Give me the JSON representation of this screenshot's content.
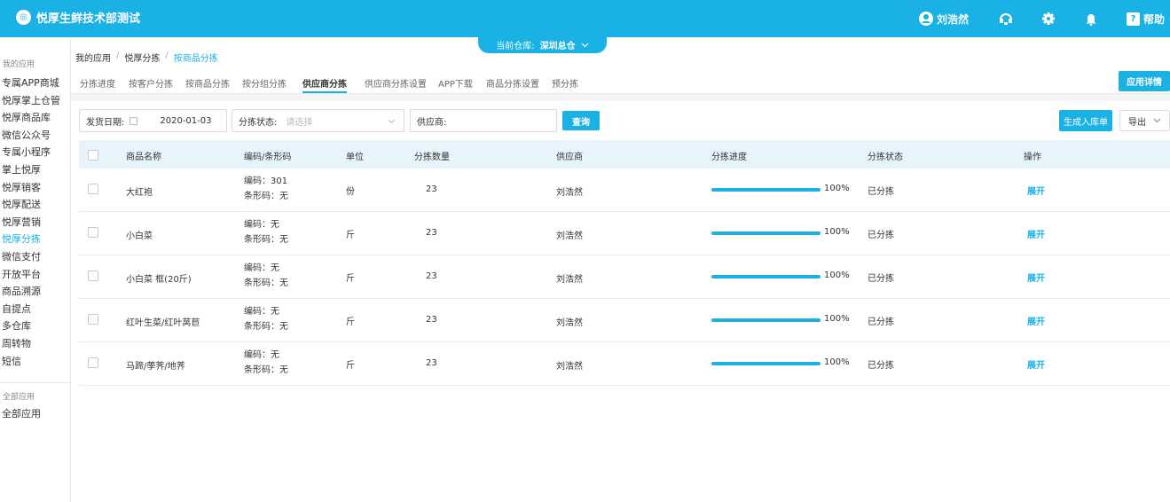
{
  "app": {
    "title": "悦厚生鲜技术部测试",
    "logo_glyph": "◎"
  },
  "top": {
    "user": "刘浩然",
    "help": "帮助",
    "accent": "#1ab1e5"
  },
  "warehouse": {
    "label": "当前仓库:",
    "value": "深圳总仓"
  },
  "sidebar": {
    "group_my": "我的应用",
    "items": [
      "专属APP商城",
      "悦厚掌上仓管",
      "悦厚商品库",
      "微信公众号",
      "专属小程序",
      "掌上悦厚",
      "悦厚销客",
      "悦厚配送",
      "悦厚营销",
      "悦厚分拣",
      "微信支付",
      "开放平台",
      "商品溯源",
      "自提点",
      "多仓库",
      "周转物",
      "短信"
    ],
    "active_index": 9,
    "group_all": "全部应用",
    "all_item": "全部应用"
  },
  "breadcrumb": [
    "我的应用",
    "悦厚分拣",
    "按商品分拣"
  ],
  "tabs": [
    "分拣进度",
    "按客户分拣",
    "按商品分拣",
    "按分组分拣",
    "供应商分拣",
    "供应商分拣设置",
    "APP下载",
    "商品分拣设置",
    "预分拣"
  ],
  "active_tab": 4,
  "app_detail_button": "应用详情",
  "filters": {
    "date_label": "发货日期:",
    "date_value": "2020-01-03",
    "status_label": "分拣状态:",
    "status_placeholder": "请选择",
    "supplier_label": "供应商:",
    "query_button": "查询",
    "inbound_button": "生成入库单",
    "export_button": "导出"
  },
  "table": {
    "headers": [
      "商品名称",
      "编码/条形码",
      "单位",
      "分拣数量",
      "供应商",
      "分拣进度",
      "分拣状态",
      "操作"
    ],
    "rows": [
      {
        "name": "大红袍",
        "code": "编码：301",
        "barcode": "条形码：无",
        "unit": "份",
        "qty": "23",
        "supplier": "刘浩然",
        "progress": 1.0,
        "progress_text": "100%",
        "status": "已分拣",
        "action": "展开"
      },
      {
        "name": "小白菜",
        "code": "编码：无",
        "barcode": "条形码：无",
        "unit": "斤",
        "qty": "23",
        "supplier": "刘浩然",
        "progress": 1.0,
        "progress_text": "100%",
        "status": "已分拣",
        "action": "展开"
      },
      {
        "name": "小白菜 框(20斤)",
        "code": "编码：无",
        "barcode": "条形码：无",
        "unit": "斤",
        "qty": "23",
        "supplier": "刘浩然",
        "progress": 1.0,
        "progress_text": "100%",
        "status": "已分拣",
        "action": "展开"
      },
      {
        "name": "红叶生菜/红叶莴苣",
        "code": "编码：无",
        "barcode": "条形码：无",
        "unit": "斤",
        "qty": "23",
        "supplier": "刘浩然",
        "progress": 1.0,
        "progress_text": "100%",
        "status": "已分拣",
        "action": "展开"
      },
      {
        "name": "马蹄/荸荠/地荠",
        "code": "编码：无",
        "barcode": "条形码：无",
        "unit": "斤",
        "qty": "23",
        "supplier": "刘浩然",
        "progress": 1.0,
        "progress_text": "100%",
        "status": "已分拣",
        "action": "展开"
      }
    ]
  }
}
